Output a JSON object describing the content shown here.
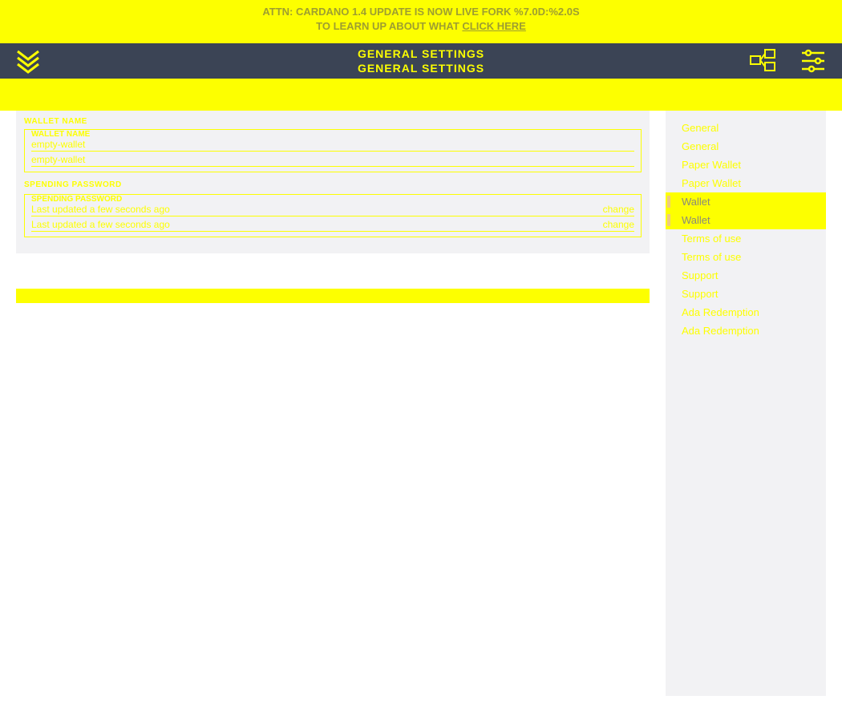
{
  "alert": {
    "line1": "ATTN: CARDANO 1.4 UPDATE IS NOW LIVE FORK %7.0D:%2.0S",
    "line2_prefix": "TO LEARN UP ABOUT WHAT ",
    "line2_link": "CLICK HERE"
  },
  "header": {
    "title": "GENERAL SETTINGS"
  },
  "form": {
    "wallet_name_label": "WALLET NAME",
    "wallet_name_value": "empty-wallet",
    "spending_password_label": "SPENDING PASSWORD",
    "spending_password_status": "Last updated a few seconds ago",
    "change_label": "change"
  },
  "sidebar": {
    "items": [
      {
        "label": "General",
        "active": false
      },
      {
        "label": "General",
        "active": false
      },
      {
        "label": "Paper Wallet",
        "active": false
      },
      {
        "label": "Paper Wallet",
        "active": false
      },
      {
        "label": "Wallet",
        "active": true
      },
      {
        "label": "Wallet",
        "active": true
      },
      {
        "label": "Terms of use",
        "active": false
      },
      {
        "label": "Terms of use",
        "active": false
      },
      {
        "label": "Support",
        "active": false
      },
      {
        "label": "Support",
        "active": false
      },
      {
        "label": "Ada Redemption",
        "active": false
      },
      {
        "label": "Ada Redemption",
        "active": false
      }
    ]
  }
}
